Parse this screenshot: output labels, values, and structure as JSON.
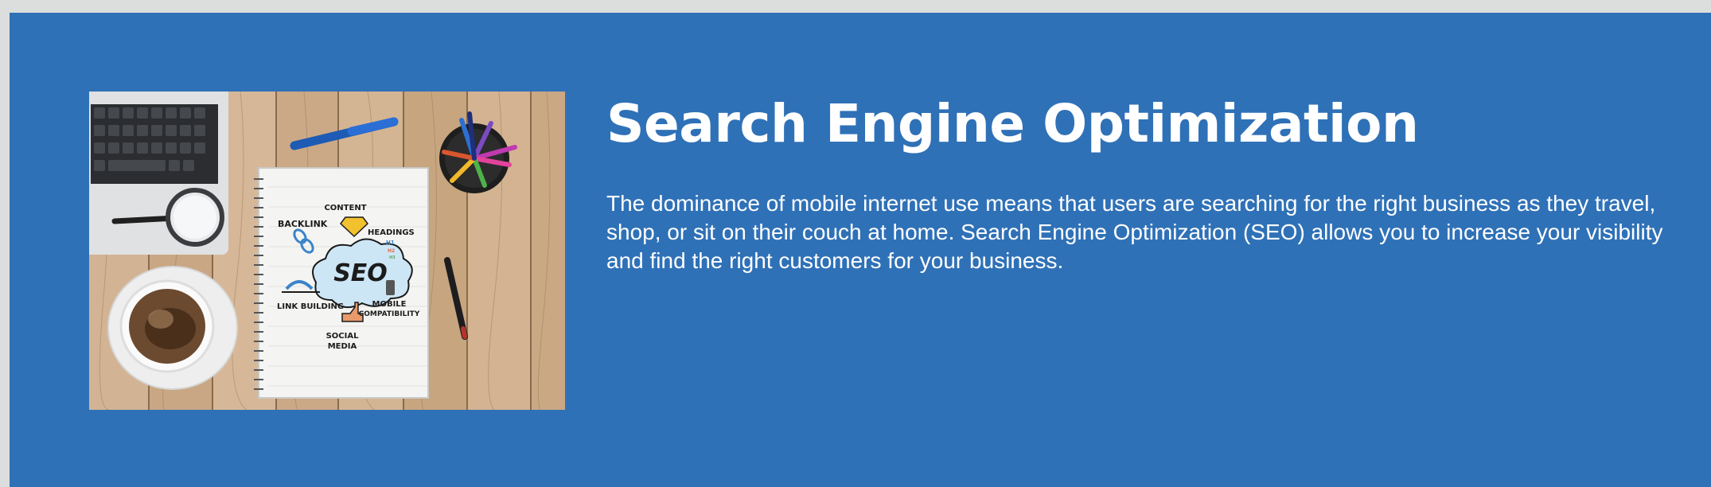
{
  "section": {
    "title": "Search Engine Optimization",
    "description": "The dominance of mobile internet use means that users are searching for the right business as they travel, shop, or sit on their couch at home. Search Engine Optimization (SEO) allows you to increase your visibility and find the right customers for your business."
  },
  "illustration": {
    "center_word": "SEO",
    "labels": {
      "content": "CONTENT",
      "backlink": "BACKLINK",
      "headings": "HEADINGS",
      "link_building": "LINK BUILDING",
      "mobile": "MOBILE",
      "compatibility": "COMPATIBILITY",
      "social": "SOCIAL",
      "media": "MEDIA",
      "h1": "H1",
      "h2": "H2",
      "h3": "H3"
    }
  },
  "colors": {
    "section_background": "#2f71b7",
    "page_background": "#dcdedd",
    "text": "#ffffff"
  }
}
